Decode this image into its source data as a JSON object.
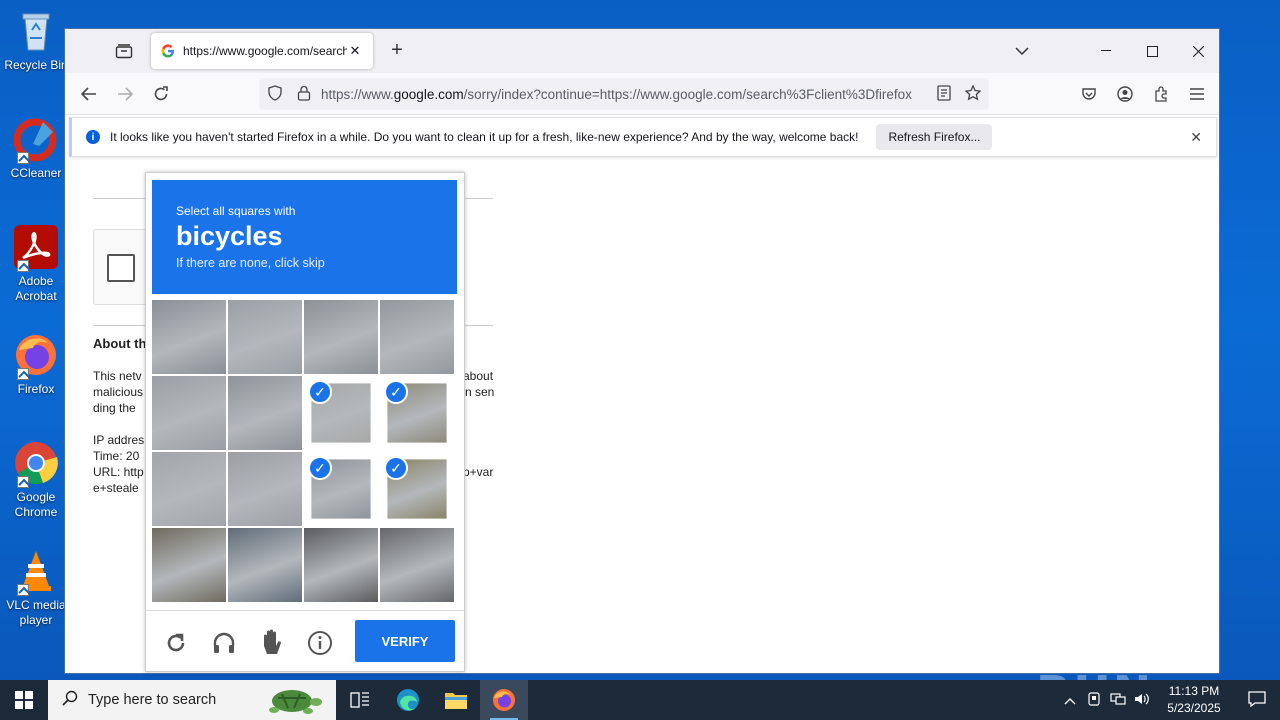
{
  "desktop": {
    "icons": [
      {
        "label": "Recycle Bin"
      },
      {
        "label": "CCleaner"
      },
      {
        "label": "Adobe Acrobat"
      },
      {
        "label": "Firefox"
      },
      {
        "label": "Google Chrome"
      },
      {
        "label": "VLC media player"
      }
    ]
  },
  "browser": {
    "tab_title": "https://www.google.com/search",
    "url_prefix": "https://www.",
    "url_domain": "google.com",
    "url_rest": "/sorry/index?continue=https://www.google.com/search%3Fclient%3Dfirefox",
    "notification": {
      "text": "It looks like you haven't started Firefox in a while. Do you want to clean it up for a fresh, like-new experience? And by the way, welcome back!",
      "button": "Refresh Firefox..."
    }
  },
  "page": {
    "about_heading": "About th",
    "line1a": "This netv",
    "line1b": "about",
    "line2a": "malicious",
    "line2b": "n sen",
    "line3": "ding the",
    "ip": "IP addres",
    "time": "Time: 20",
    "url_a": "URL: http",
    "url_b": "p+var",
    "url_c": "e+steale"
  },
  "captcha": {
    "instruction": "Select all squares with",
    "target": "bicycles",
    "hint": "If there are none, click skip",
    "verify_label": "VERIFY",
    "selected_cells": [
      6,
      7,
      10,
      11
    ]
  },
  "watermark": "ANY RUN",
  "taskbar": {
    "search_placeholder": "Type here to search",
    "time": "11:13 PM",
    "date": "5/23/2025"
  }
}
